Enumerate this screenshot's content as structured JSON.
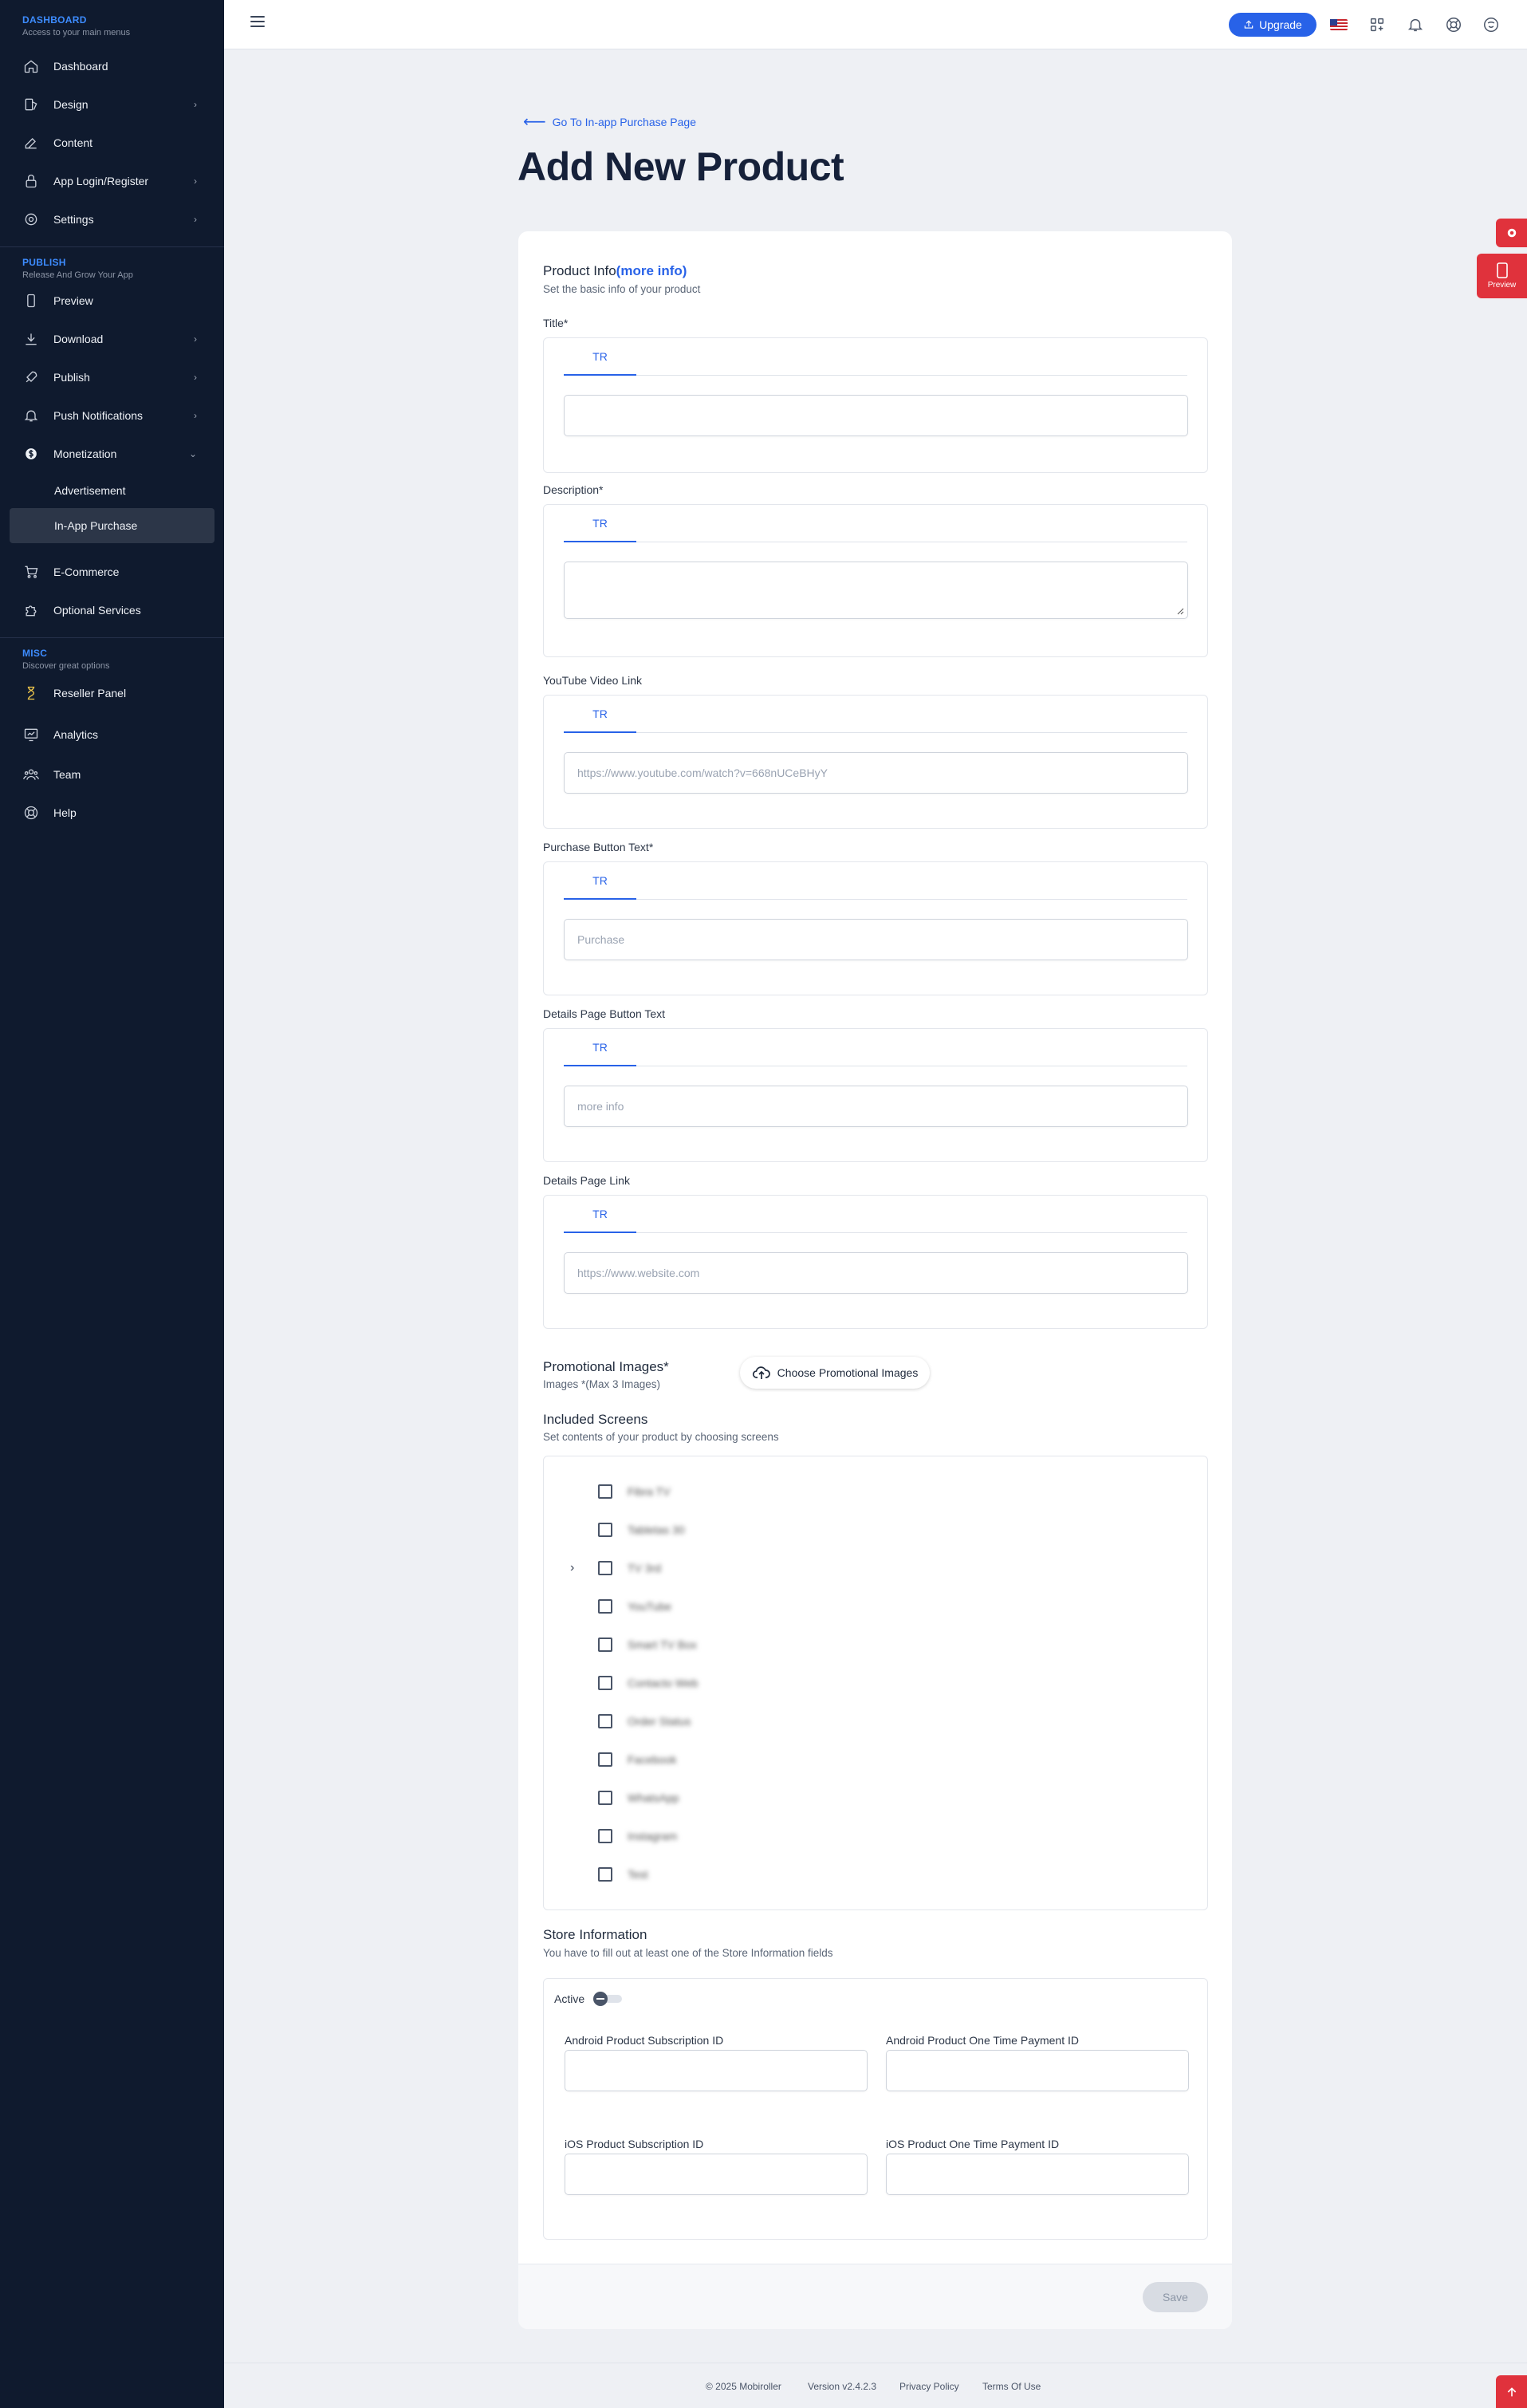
{
  "sidebar": {
    "dashboard": {
      "title": "DASHBOARD",
      "subtitle": "Access to your main menus"
    },
    "dashboard_items": [
      {
        "label": "Dashboard",
        "icon": "home-icon"
      },
      {
        "label": "Design",
        "icon": "design-icon",
        "has_chevron": true
      },
      {
        "label": "Content",
        "icon": "edit-icon"
      },
      {
        "label": "App Login/Register",
        "icon": "lock-icon",
        "has_chevron": true
      },
      {
        "label": "Settings",
        "icon": "gear-icon",
        "has_chevron": true
      }
    ],
    "publish": {
      "title": "PUBLISH",
      "subtitle": "Release And Grow Your App"
    },
    "publish_items": [
      {
        "label": "Preview",
        "icon": "phone-icon"
      },
      {
        "label": "Download",
        "icon": "download-icon",
        "has_chevron": true
      },
      {
        "label": "Publish",
        "icon": "rocket-icon",
        "has_chevron": true
      },
      {
        "label": "Push Notifications",
        "icon": "bell-icon",
        "has_chevron": true
      },
      {
        "label": "Monetization",
        "icon": "dollar-icon",
        "expanded": true
      }
    ],
    "monetization_sub": [
      "Advertisement",
      "In-App Purchase"
    ],
    "more_items": [
      {
        "label": "E-Commerce",
        "icon": "cart-icon"
      },
      {
        "label": "Optional Services",
        "icon": "puzzle-icon"
      }
    ],
    "misc": {
      "title": "MISC",
      "subtitle": "Discover great options"
    },
    "misc_items": [
      {
        "label": "Reseller Panel",
        "icon": "hourglass-icon"
      },
      {
        "label": "Analytics",
        "icon": "analytics-icon"
      },
      {
        "label": "Team",
        "icon": "team-icon"
      },
      {
        "label": "Help",
        "icon": "help-icon"
      }
    ]
  },
  "topbar": {
    "upgrade_label": "Upgrade",
    "icons": [
      "us-flag-icon",
      "apps-icon",
      "bell-icon",
      "support-icon",
      "user-icon"
    ]
  },
  "page": {
    "back_label": "Go To In-app Purchase Page",
    "title": "Add New Product"
  },
  "product_info": {
    "title": "Product Info",
    "more_info": "(more info)",
    "subtitle": "Set the basic info of your product"
  },
  "fields": [
    {
      "label": "Title*",
      "tab": "TR",
      "value": "",
      "placeholder": ""
    },
    {
      "label": "Description*",
      "tab": "TR",
      "value": "",
      "placeholder": "",
      "multiline": true
    },
    {
      "label": "YouTube Video Link",
      "tab": "TR",
      "value": "",
      "placeholder": "https://www.youtube.com/watch?v=668nUCeBHyY"
    },
    {
      "label": "Purchase Button Text*",
      "tab": "TR",
      "value": "",
      "placeholder": "Purchase"
    },
    {
      "label": "Details Page Button Text",
      "tab": "TR",
      "value": "",
      "placeholder": "more info"
    },
    {
      "label": "Details Page Link",
      "tab": "TR",
      "value": "",
      "placeholder": "https://www.website.com"
    }
  ],
  "promo": {
    "title": "Promotional Images*",
    "subtitle": "Images *(Max 3 Images)",
    "button_label": "Choose Promotional Images"
  },
  "screens": {
    "title": "Included Screens",
    "subtitle": "Set contents of your product by choosing screens",
    "items": [
      {
        "label": "Fibra TV",
        "checked": false
      },
      {
        "label": "Tabletas 30",
        "checked": false
      },
      {
        "label": "TV 3rd",
        "checked": false,
        "expandable": true
      },
      {
        "label": "YouTube",
        "checked": false
      },
      {
        "label": "Smart TV Box",
        "checked": false
      },
      {
        "label": "Contacto Web",
        "checked": false
      },
      {
        "label": "Order Status",
        "checked": false
      },
      {
        "label": "Facebook",
        "checked": false
      },
      {
        "label": "WhatsApp",
        "checked": false
      },
      {
        "label": "Instagram",
        "checked": false
      },
      {
        "label": "Test",
        "checked": false
      }
    ]
  },
  "store": {
    "title": "Store Information",
    "subtitle": "You have to fill out at least one of the Store Information fields",
    "active_label": "Active",
    "active": false,
    "fields": [
      {
        "label": "Android Product Subscription ID",
        "value": ""
      },
      {
        "label": "Android Product One Time Payment ID",
        "value": ""
      },
      {
        "label": "iOS Product Subscription ID",
        "value": ""
      },
      {
        "label": "iOS Product One Time Payment ID",
        "value": ""
      }
    ]
  },
  "save_label": "Save",
  "floating": {
    "preview_label": "Preview"
  },
  "footer": {
    "copyright": "© 2025 Mobiroller",
    "version": "Version v2.4.2.3",
    "privacy": "Privacy Policy",
    "terms": "Terms Of Use"
  },
  "colors": {
    "accent": "#2862e8",
    "sidebar_bg": "#0f1a2e",
    "danger": "#e0323c"
  }
}
